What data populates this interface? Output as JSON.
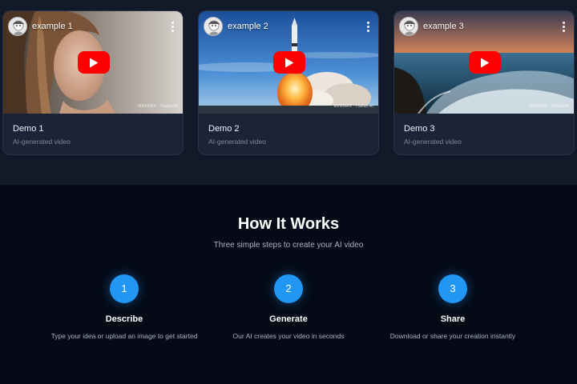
{
  "colors": {
    "page_bg": "#050a16",
    "top_section_bg": "#121a29",
    "card_bg": "#1b2436",
    "play_button": "#ff0000",
    "step_circle": "#2196f3"
  },
  "demos": [
    {
      "thumbnail_title": "example 1",
      "name": "Demo 1",
      "subtitle": "AI-generated video",
      "watermark": "MINIMAX · Hailuo AI",
      "scene": "portrait",
      "icons": [
        "avatar-icon",
        "kebab-menu-icon",
        "play-icon"
      ]
    },
    {
      "thumbnail_title": "example 2",
      "name": "Demo 2",
      "subtitle": "AI-generated video",
      "watermark": "MINIMAX · Hailuo AI",
      "scene": "rocket-launch",
      "icons": [
        "avatar-icon",
        "kebab-menu-icon",
        "play-icon"
      ]
    },
    {
      "thumbnail_title": "example 3",
      "name": "Demo 3",
      "subtitle": "AI-generated video",
      "watermark": "MINIMAX · Hailuo AI",
      "scene": "ocean-sunset",
      "icons": [
        "avatar-icon",
        "kebab-menu-icon",
        "play-icon"
      ]
    }
  ],
  "how_it_works": {
    "title": "How It Works",
    "subtitle": "Three simple steps to create your AI video",
    "steps": [
      {
        "number": "1",
        "title": "Describe",
        "description": "Type your idea or upload an image to get started"
      },
      {
        "number": "2",
        "title": "Generate",
        "description": "Our AI creates your video in seconds"
      },
      {
        "number": "3",
        "title": "Share",
        "description": "Download or share your creation instantly"
      }
    ]
  }
}
